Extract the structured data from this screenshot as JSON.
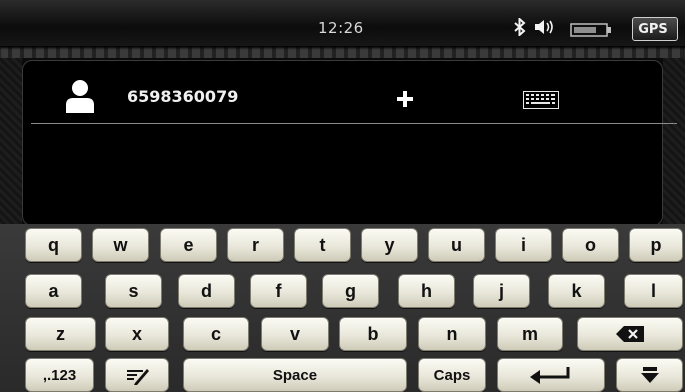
{
  "status_bar": {
    "time": "12:26",
    "icons": [
      "bluetooth-icon",
      "volume-icon",
      "battery-icon"
    ],
    "gps_label": "GPS"
  },
  "recipient": {
    "phone_number": "6598360079",
    "icons": [
      "contact-icon",
      "add-icon",
      "keyboard-icon"
    ]
  },
  "keyboard": {
    "row1": [
      "q",
      "w",
      "e",
      "r",
      "t",
      "y",
      "u",
      "i",
      "o",
      "p"
    ],
    "row2": [
      "a",
      "s",
      "d",
      "f",
      "g",
      "h",
      "j",
      "k",
      "l"
    ],
    "row3": [
      "z",
      "x",
      "c",
      "v",
      "b",
      "n",
      "m"
    ],
    "row4": {
      "numbers_label": ",.123",
      "space_label": "Space",
      "caps_label": "Caps"
    },
    "special_icons": [
      "backspace-icon",
      "handwriting-icon",
      "enter-icon",
      "hide-keyboard-icon"
    ]
  },
  "colors": {
    "background": "#000000",
    "key_face": "#eceadc",
    "key_text": "#111111",
    "divider": "#8a8a8a"
  }
}
